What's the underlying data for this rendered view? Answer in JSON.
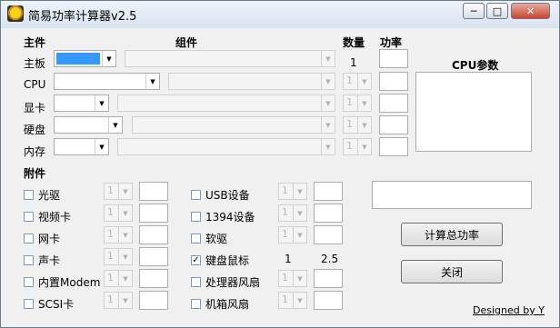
{
  "window": {
    "title": "简易功率计算器v2.5",
    "min_glyph": "─",
    "max_glyph": "□",
    "close_glyph": "✕"
  },
  "main_header": {
    "main": "主件",
    "component": "组件",
    "quantity": "数量",
    "power": "功率"
  },
  "main_rows": [
    {
      "label": "主板",
      "qty": "1"
    },
    {
      "label": "CPU",
      "qty": "1"
    },
    {
      "label": "显卡",
      "qty": "1"
    },
    {
      "label": "硬盘",
      "qty": "1"
    },
    {
      "label": "内存",
      "qty": "1"
    }
  ],
  "cpu_panel": {
    "title": "CPU参数"
  },
  "accessories": {
    "header": "附件",
    "left": [
      {
        "label": "光驱",
        "qty": "1",
        "checked": false
      },
      {
        "label": "视频卡",
        "qty": "1",
        "checked": false
      },
      {
        "label": "网卡",
        "qty": "1",
        "checked": false
      },
      {
        "label": "声卡",
        "qty": "1",
        "checked": false
      },
      {
        "label": "内置Modem",
        "qty": "1",
        "checked": false
      },
      {
        "label": "SCSI卡",
        "qty": "1",
        "checked": false
      }
    ],
    "right": [
      {
        "label": "USB设备",
        "qty": "1",
        "checked": false
      },
      {
        "label": "1394设备",
        "qty": "1",
        "checked": false
      },
      {
        "label": "软驱",
        "qty": "1",
        "checked": false
      },
      {
        "label": "键盘鼠标",
        "qty": "1",
        "checked": true,
        "power": "2.5"
      },
      {
        "label": "处理器风扇",
        "qty": "1",
        "checked": false
      },
      {
        "label": "机箱风扇",
        "qty": "1",
        "checked": false
      }
    ]
  },
  "buttons": {
    "calculate": "计算总功率",
    "close": "关闭"
  },
  "footer": {
    "credit": "Designed by Y"
  },
  "colors": {
    "selection": "#3399ff",
    "window_bg": "#f0f0f0"
  }
}
